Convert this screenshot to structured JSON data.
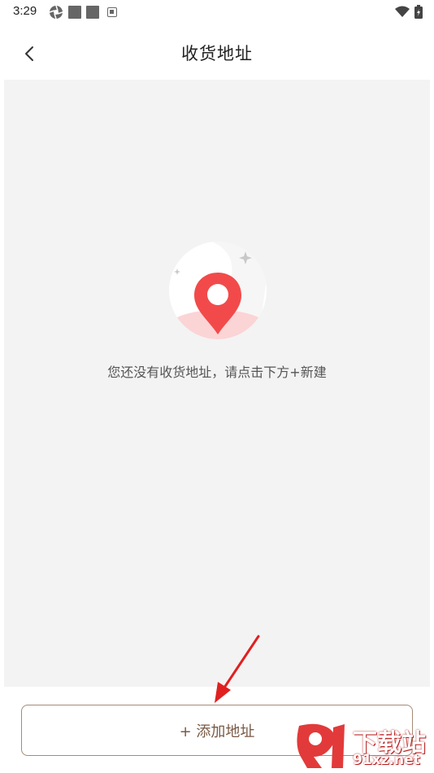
{
  "status_bar": {
    "time": "3:29",
    "left_icons": [
      "aperture-icon",
      "square-icon",
      "square-icon",
      "app-notification-icon"
    ],
    "right_icons": [
      "wifi-icon",
      "battery-icon"
    ]
  },
  "header": {
    "back_icon": "chevron-left-icon",
    "title": "收货地址"
  },
  "empty_state": {
    "illustration_icon": "location-pin-icon",
    "message": "您还没有收货地址，请点击下方+新建"
  },
  "footer": {
    "add_button_label": "+ 添加地址"
  },
  "watermark": {
    "top_text": "下载站",
    "bottom_text": "91xz.net"
  },
  "colors": {
    "content_bg": "#f3f3f3",
    "pin_red": "#f24a4a",
    "button_border": "#a58b76",
    "button_text": "#7a5a45",
    "annotation_red": "#e02020"
  }
}
